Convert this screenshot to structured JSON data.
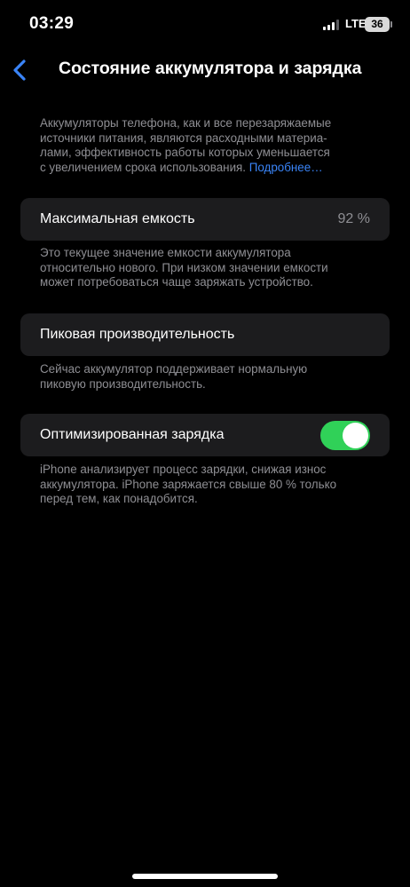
{
  "status_bar": {
    "time": "03:29",
    "network": "LTE",
    "battery_level": "36",
    "signal_bars_total": 4,
    "signal_bars_active": 3
  },
  "nav": {
    "back_icon": "chevron-left-icon",
    "title": "Состояние аккумулятора и зарядка"
  },
  "intro": {
    "lines": [
      "Аккумуляторы телефона, как и все перезаряжаемые",
      "источники питания, являются расходными материа-",
      "лами, эффективность работы которых уменьшается",
      "с увеличением срока использования. "
    ],
    "link": "Подробнее…"
  },
  "max_capacity": {
    "label": "Максимальная емкость",
    "value": "92 %",
    "footer_lines": [
      "Это текущее значение емкости аккумулятора",
      "относительно нового. При низком значении емкости",
      "может потребоваться чаще заряжать устройство."
    ]
  },
  "peak_performance": {
    "label": "Пиковая производительность",
    "footer_lines": [
      "Сейчас аккумулятор поддерживает нормальную",
      "пиковую производительность."
    ]
  },
  "optimized_charging": {
    "label": "Оптимизированная зарядка",
    "enabled": true,
    "footer_lines": [
      "iPhone анализирует процесс зарядки, снижая износ",
      "аккумулятора. iPhone заряжается свыше 80 % только",
      "перед тем, как понадобится."
    ]
  },
  "colors": {
    "background": "#000000",
    "cell": "#1c1c1e",
    "secondary_text": "#8e8e93",
    "accent": "#3a84f7",
    "toggle_on": "#30d158"
  }
}
